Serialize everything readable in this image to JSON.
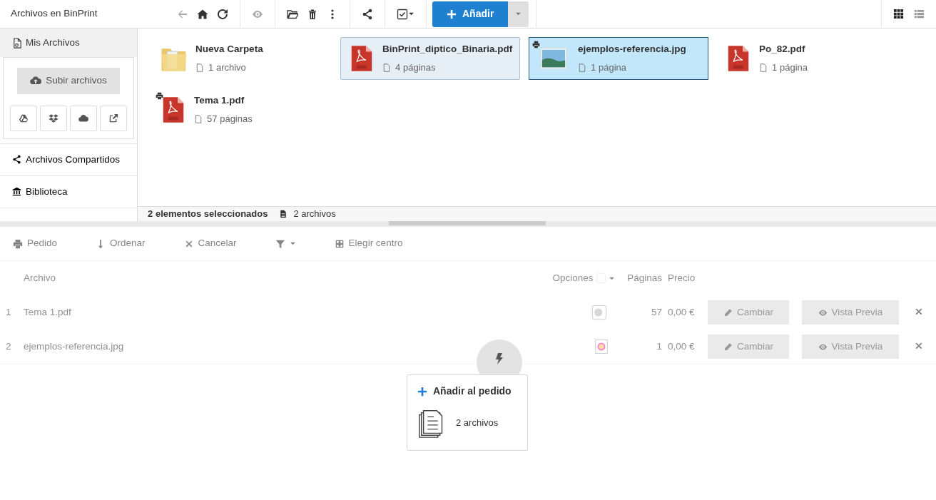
{
  "header": {
    "title": "Archivos en BinPrint"
  },
  "toolbar": {
    "groups": [
      [
        {
          "kind": "back",
          "disabled": true
        },
        {
          "kind": "home",
          "disabled": false
        },
        {
          "kind": "refresh",
          "disabled": false
        }
      ],
      [
        {
          "kind": "view",
          "disabled": true
        }
      ],
      [
        {
          "kind": "folder",
          "disabled": false
        },
        {
          "kind": "trash",
          "disabled": false
        },
        {
          "kind": "more",
          "disabled": false
        }
      ],
      [
        {
          "kind": "share",
          "disabled": false
        }
      ],
      [
        {
          "kind": "select",
          "disabled": false
        }
      ]
    ],
    "add_button": "Añadir",
    "views": [
      {
        "kind": "grid",
        "selected": true
      },
      {
        "kind": "list",
        "selected": false
      }
    ]
  },
  "sidebar": {
    "header": "Mis Archivos",
    "upload_button": "Subir archivos",
    "items": [
      {
        "kind": "share",
        "label": "Archivos Compartidos"
      },
      {
        "kind": "library",
        "label": "Biblioteca"
      }
    ]
  },
  "files": [
    {
      "kind": "folder",
      "name": "Nueva Carpeta",
      "info": "1 archivo",
      "selected": false,
      "focused": false,
      "in_order": false
    },
    {
      "kind": "pdf",
      "name": "BinPrint_diptico_Binaria.pdf",
      "info": "4 páginas",
      "selected": true,
      "focused": false,
      "in_order": false
    },
    {
      "kind": "image",
      "name": "ejemplos-referencia.jpg",
      "info": "1 página",
      "selected": true,
      "focused": true,
      "in_order": true
    },
    {
      "kind": "pdf",
      "name": "Po_82.pdf",
      "info": "1 página",
      "selected": false,
      "focused": false,
      "in_order": false
    },
    {
      "kind": "pdf",
      "name": "Tema 1.pdf",
      "info": "57 páginas",
      "selected": false,
      "focused": false,
      "in_order": true
    }
  ],
  "status_bar": {
    "selection": "2 elementos seleccionados",
    "files": "2 archivos"
  },
  "order": {
    "disabled": true,
    "toolbar": [
      {
        "kind": "print",
        "label": "Pedido"
      },
      {
        "kind": "sort",
        "label": "Ordenar"
      },
      {
        "kind": "cancel",
        "label": "Cancelar"
      },
      {
        "kind": "filter"
      },
      {
        "kind": "center",
        "label": "Elegir centro"
      }
    ],
    "columns": {
      "file": "Archivo",
      "options": "Opciones",
      "options_checked": false,
      "pages": "Páginas",
      "price": "Precio"
    },
    "rows": [
      {
        "index": "1",
        "file": "Tema 1.pdf",
        "kind": "bw",
        "pages": "57",
        "price": "0,00 €",
        "change": "Cambiar",
        "preview": "Vista Previa",
        "remove": "✕"
      },
      {
        "index": "2",
        "file": "ejemplos-referencia.jpg",
        "kind": "color",
        "pages": "1",
        "price": "0,00 €",
        "change": "Cambiar",
        "preview": "Vista Previa",
        "remove": "✕"
      }
    ]
  },
  "popup": {
    "title": "Añadir al pedido",
    "count": "2 archivos"
  }
}
